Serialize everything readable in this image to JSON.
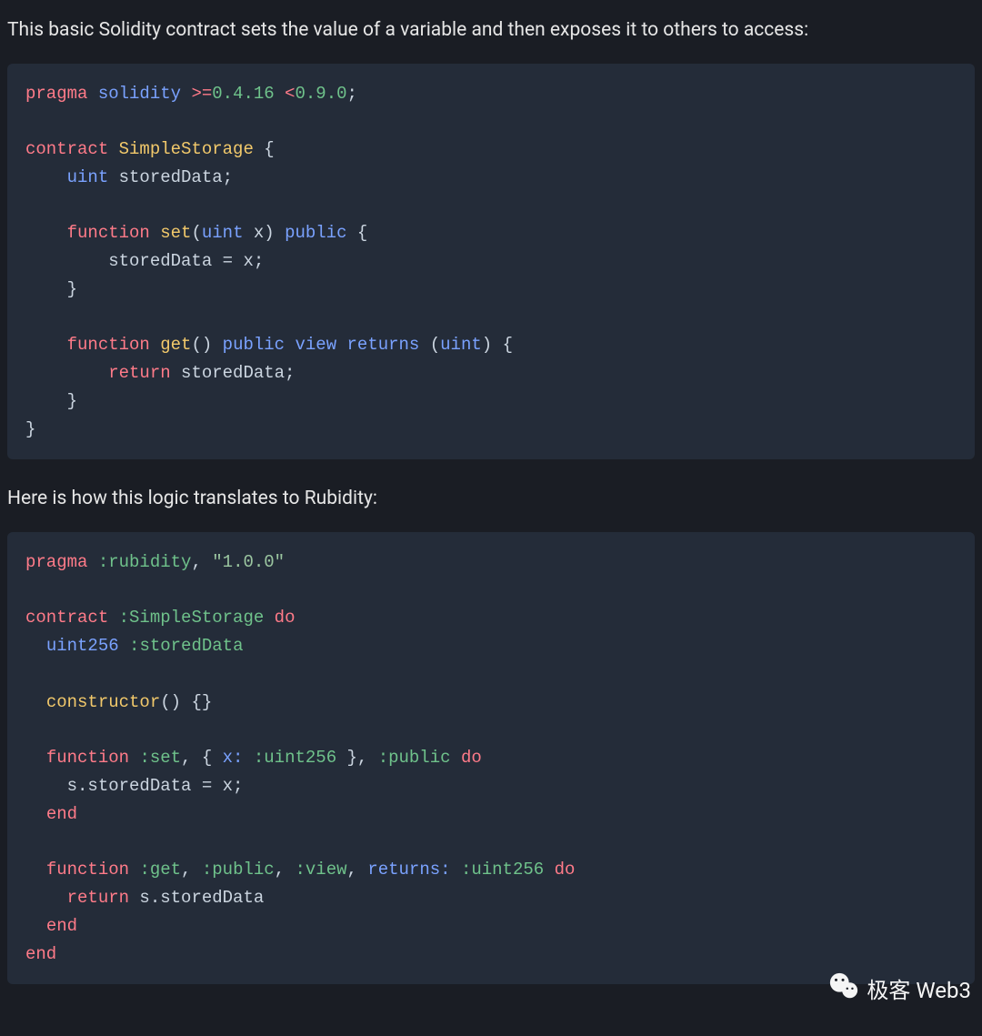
{
  "para1": "This basic Solidity contract sets the value of a variable and then exposes it to others to access:",
  "para2": "Here is how this logic translates to Rubidity:",
  "watermark": "极客 Web3",
  "code1": {
    "line1_pragma": "pragma",
    "line1_solidity": "solidity",
    "line1_gte": ">=",
    "line1_v1": "0.4.16",
    "line1_lt": "<",
    "line1_v2": "0.9.0",
    "line1_semi": ";",
    "line3_contract": "contract",
    "line3_name": "SimpleStorage",
    "line3_brace": " {",
    "line4_indent": "    ",
    "line4_uint": "uint",
    "line4_var": " storedData;",
    "line6_indent": "    ",
    "line6_function": "function",
    "line6_set": "set",
    "line6_paren_open": "(",
    "line6_uint": "uint",
    "line6_x": " x) ",
    "line6_public": "public",
    "line6_brace": " {",
    "line7": "        storedData = x;",
    "line8": "    }",
    "line10_indent": "    ",
    "line10_function": "function",
    "line10_get": "get",
    "line10_parens": "() ",
    "line10_public": "public",
    "line10_sp1": " ",
    "line10_view": "view",
    "line10_sp2": " ",
    "line10_returns": "returns",
    "line10_sp3": " (",
    "line10_uint": "uint",
    "line10_brace": ") {",
    "line11_indent": "        ",
    "line11_return": "return",
    "line11_rest": " storedData;",
    "line12": "    }",
    "line13": "}"
  },
  "code2": {
    "l1_pragma": "pragma",
    "l1_sp": " ",
    "l1_sym": ":rubidity",
    "l1_comma": ", ",
    "l1_str": "\"1.0.0\"",
    "l3_contract": "contract",
    "l3_sp": " ",
    "l3_sym": ":SimpleStorage",
    "l3_sp2": " ",
    "l3_do": "do",
    "l4_indent": "  ",
    "l4_uint": "uint256",
    "l4_sp": " ",
    "l4_sym": ":storedData",
    "l6_indent": "  ",
    "l6_ctor": "constructor",
    "l6_rest": "() {}",
    "l8_indent": "  ",
    "l8_function": "function",
    "l8_sp": " ",
    "l8_set": ":set",
    "l8_mid1": ", { ",
    "l8_x": "x:",
    "l8_sp2": " ",
    "l8_uintsym": ":uint256",
    "l8_mid2": " }, ",
    "l8_public": ":public",
    "l8_sp3": " ",
    "l8_do": "do",
    "l9": "    s.storedData = x;",
    "l10_indent": "  ",
    "l10_end": "end",
    "l12_indent": "  ",
    "l12_function": "function",
    "l12_sp": " ",
    "l12_get": ":get",
    "l12_c1": ", ",
    "l12_public": ":public",
    "l12_c2": ", ",
    "l12_view": ":view",
    "l12_c3": ", ",
    "l12_returns": "returns:",
    "l12_sp2": " ",
    "l12_uintsym": ":uint256",
    "l12_sp3": " ",
    "l12_do": "do",
    "l13_indent": "    ",
    "l13_return": "return",
    "l13_rest": " s.storedData",
    "l14_indent": "  ",
    "l14_end": "end",
    "l15_end": "end"
  }
}
